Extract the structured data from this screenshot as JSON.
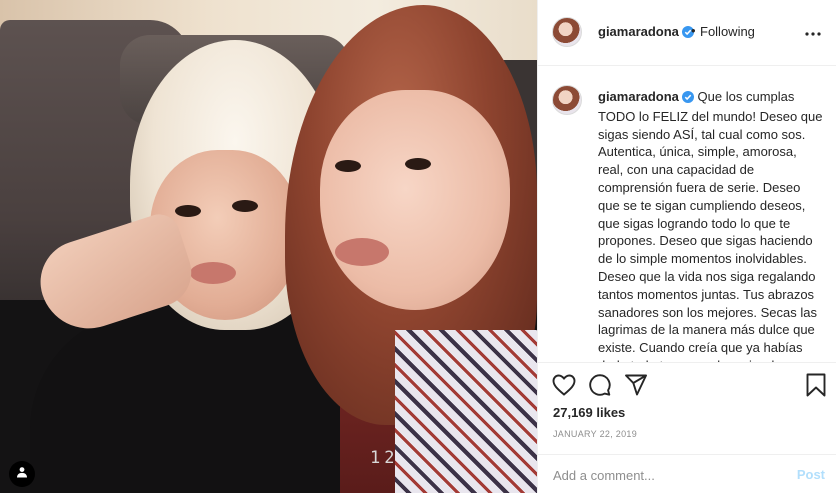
{
  "post": {
    "username": "giamaradona",
    "verified_icon": "verified-badge-icon",
    "follow_separator": "•",
    "follow_status": "Following",
    "caption": "Que los cumplas TODO lo FELIZ del mundo! Deseo que sigas siendo ASÍ, tal cual como sos. Autentica, única, simple, amorosa, real, con una capacidad de comprensión fuera de serie. Deseo que se te sigan cumpliendo deseos, que sigas logrando todo lo que te propones. Deseo que sigas haciendo de lo simple momentos inolvidables. Deseo que la vida nos siga regalando tantos momentos juntas. Tus abrazos sanadores son los mejores. Secas las lagrimas de la manera más dulce que existe. Cuando creía que ya habías dado todo tu amor y lo mejor de vos, llega Benja a tu vida para darte un",
    "likes": "27,169 likes",
    "date": "JANUARY 22, 2019",
    "photo_overlay_text": "12"
  },
  "comment": {
    "placeholder": "Add a comment...",
    "post_label": "Post"
  },
  "colors": {
    "verified": "#3897f0",
    "post_button_disabled": "#b2dffc",
    "secondary_text": "#8e8e8e"
  },
  "icons": {
    "like": "heart-icon",
    "comment": "comment-bubble-icon",
    "share": "paper-plane-icon",
    "save": "bookmark-icon",
    "more": "more-options-icon",
    "tag": "user-tag-icon"
  }
}
